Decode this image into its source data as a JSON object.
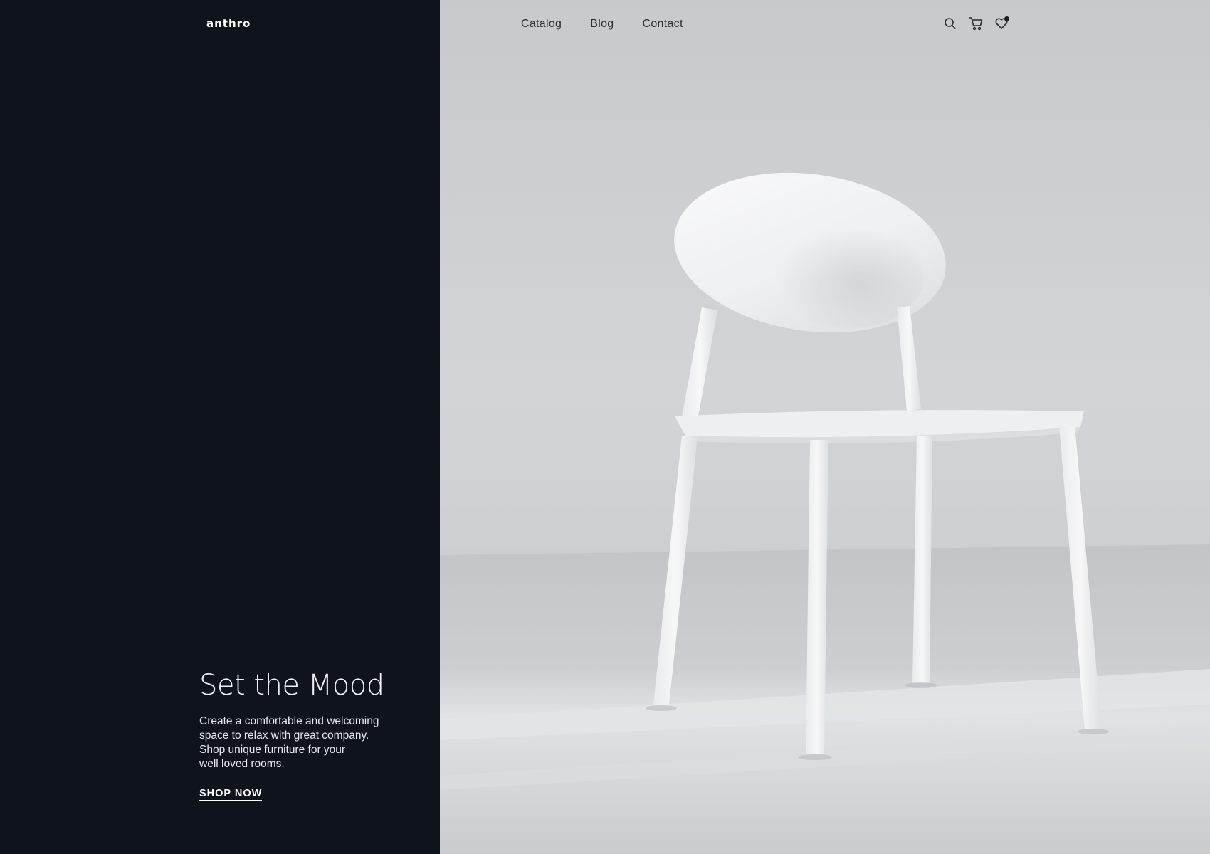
{
  "brand": {
    "logo_text": "anthro"
  },
  "nav": {
    "items": [
      {
        "label": "Catalog"
      },
      {
        "label": "Blog"
      },
      {
        "label": "Contact"
      }
    ]
  },
  "header_icons": {
    "search": "search-icon",
    "cart": "cart-icon",
    "wishlist": "heart-icon"
  },
  "hero": {
    "title": "Set the Mood",
    "text_lines": [
      "Create a comfortable and welcoming",
      "space to relax with great company.",
      "Shop unique furniture for your",
      "well loved rooms."
    ],
    "cta_label": "SHOP NOW"
  },
  "colors": {
    "dark_panel": "#0f131c",
    "image_bg": "#cdced1",
    "text_light": "#ffffff",
    "nav_text": "#2b2e35"
  }
}
